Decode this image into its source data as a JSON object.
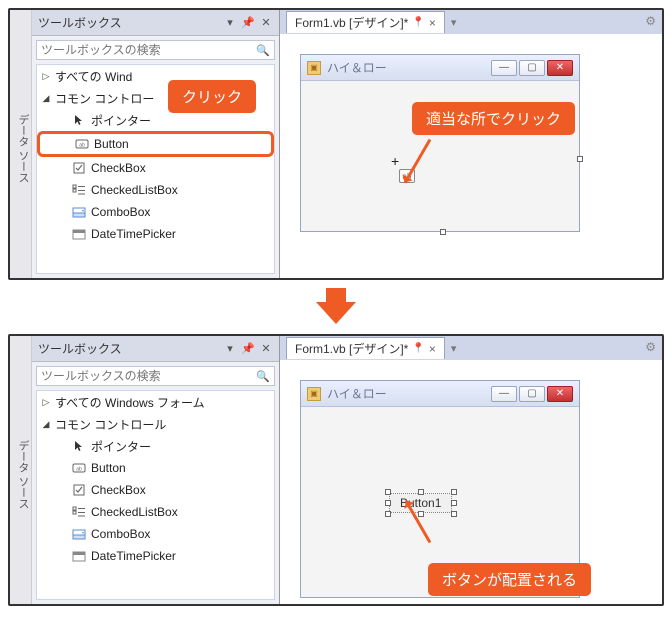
{
  "sidebar_tab": "データ ソース",
  "toolbox": {
    "title": "ツールボックス",
    "search_placeholder": "ツールボックスの検索",
    "group1_truncated": "すべての Wind",
    "group1_full": "すべての Windows フォーム",
    "group2_truncated": "コモン コントロー",
    "group2_full": "コモン コントロール",
    "items": {
      "pointer_truncated": "ポインター",
      "pointer_full": "ポインター",
      "button": "Button",
      "checkbox": "CheckBox",
      "checkedlistbox": "CheckedListBox",
      "combobox": "ComboBox",
      "datetimepicker": "DateTimePicker"
    }
  },
  "doc_tab": "Form1.vb [デザイン]*",
  "win_title": "ハイ＆ロー",
  "button_text": "Button1",
  "callouts": {
    "click": "クリック",
    "click_anywhere": "適当な所でクリック",
    "button_placed": "ボタンが配置される"
  }
}
